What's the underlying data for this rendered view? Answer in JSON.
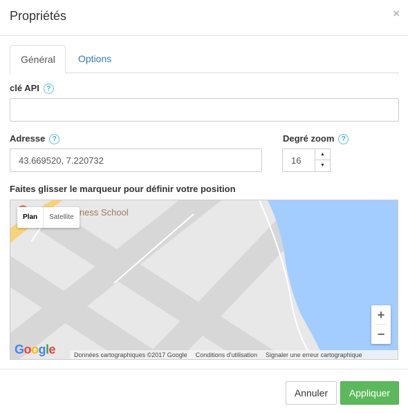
{
  "dialog": {
    "title": "Propriétés",
    "close_symbol": "×"
  },
  "tabs": [
    {
      "label": "Général",
      "active": true
    },
    {
      "label": "Options",
      "active": false
    }
  ],
  "form": {
    "api_key": {
      "label": "clé API",
      "help": "?",
      "value": ""
    },
    "address": {
      "label": "Adresse",
      "help": "?",
      "value": "43.669520, 7.220732"
    },
    "zoom": {
      "label": "Degré zoom",
      "help": "?",
      "value": "16",
      "up_icon": "▲",
      "down_icon": "▼"
    },
    "map_instruction": "Faites glisser le marqueur pour définir votre position"
  },
  "map": {
    "poi_label": "iness School",
    "map_types": [
      "Plan",
      "Satellite"
    ],
    "selected_type": "Plan",
    "zoom_in": "+",
    "zoom_out": "−",
    "logo": {
      "letters": [
        "G",
        "o",
        "o",
        "g",
        "l",
        "e"
      ],
      "colors": [
        "#4285f4",
        "#ea4335",
        "#fbbc05",
        "#4285f4",
        "#34a853",
        "#ea4335"
      ]
    },
    "attribution": [
      "Données cartographiques ©2017 Google",
      "Conditions d'utilisation",
      "Signaler une erreur cartographique"
    ],
    "colors": {
      "water": "#a3ccff",
      "land": "#e8e8e8",
      "roads": "#d7d7d7",
      "highway": "#f6d37a"
    }
  },
  "footer": {
    "cancel_label": "Annuler",
    "apply_label": "Appliquer"
  },
  "colors": {
    "link": "#337ab7",
    "help": "#31b0d5",
    "apply": "#5cb85c"
  }
}
